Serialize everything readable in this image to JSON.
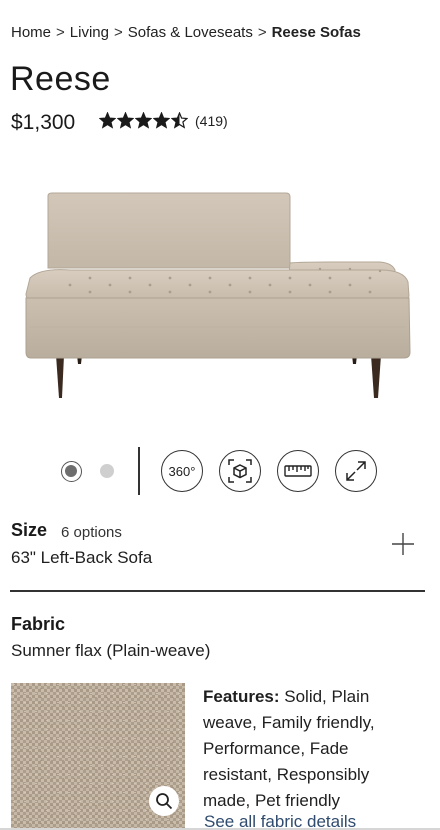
{
  "breadcrumb": {
    "items": [
      "Home",
      "Living",
      "Sofas & Loveseats"
    ],
    "separator": ">",
    "current": "Reese Sofas"
  },
  "product": {
    "title": "Reese",
    "price": "$1,300",
    "rating": 4.5,
    "rating_max": 5,
    "review_count": "(419)"
  },
  "gallery": {
    "image_index": 1,
    "image_count": 2,
    "btn_360_label": "360°",
    "icons": [
      "ar-cube-icon",
      "ruler-icon",
      "expand-icon"
    ]
  },
  "size": {
    "label": "Size",
    "options_text": "6 options",
    "selected": "63\" Left-Back Sofa"
  },
  "fabric": {
    "label": "Fabric",
    "selected": "Sumner flax (Plain-weave)",
    "features_label": "Features:",
    "features_text": " Solid, Plain weave, Family friendly, Performance, Fade resistant, Responsibly made, Pet friendly",
    "details_link": "See all fabric details"
  },
  "colors": {
    "upholstery": "#c8bcad",
    "legs": "#3a2a20",
    "text": "#1f1f1f",
    "link": "#2f4b6e"
  }
}
